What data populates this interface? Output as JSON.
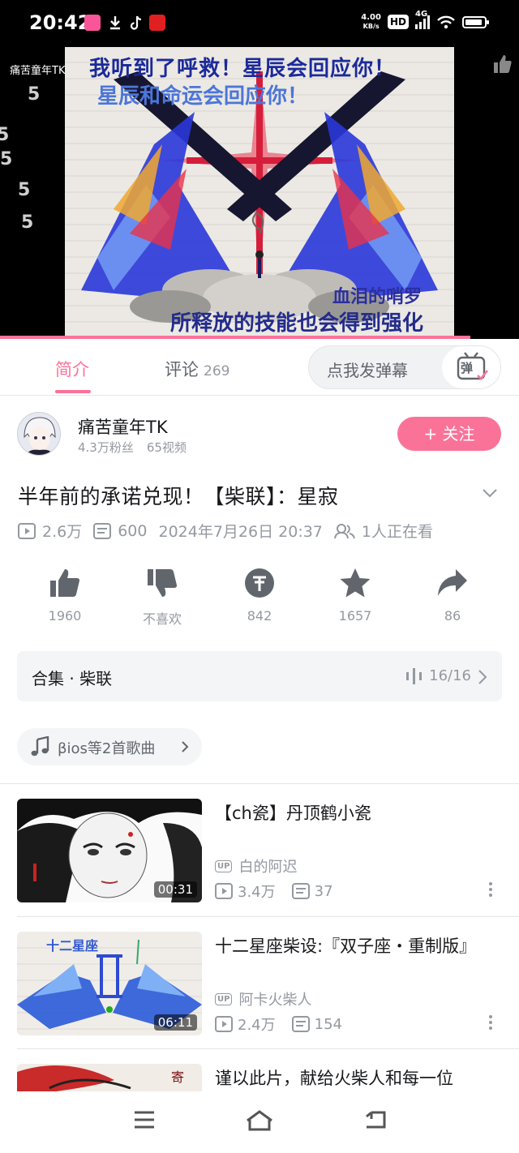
{
  "status_bar": {
    "time": "20:42",
    "speed_value": "4.00",
    "speed_unit": "KB/s",
    "hd_label": "HD",
    "network": "4G"
  },
  "video": {
    "danmaku_user": "痛苦童年TK",
    "danmaku_numbers": [
      "5",
      "5",
      "5",
      "5",
      "5"
    ],
    "overlay_line1": "我听到了呼救！星辰会回应你！",
    "overlay_line1b": "星辰和命运会回应你！",
    "overlay_line2": "血泪的哨罗",
    "overlay_line3": "所释放的技能也会得到强化",
    "progress_fraction": 0.906
  },
  "tabs": {
    "intro": "简介",
    "comments": "评论",
    "comments_count": "269",
    "danmaku_placeholder": "点我发弹幕",
    "danmaku_button": "弹"
  },
  "uploader": {
    "name": "痛苦童年TK",
    "fans": "4.3万粉丝",
    "videos": "65视频",
    "follow_label": "+ 关注"
  },
  "video_info": {
    "title": "半年前的承诺兑现！【柴联】：星寂",
    "views": "2.6万",
    "danmaku_count": "600",
    "date": "2024年7月26日 20:37",
    "watching": "1人正在看"
  },
  "actions": [
    {
      "label": "1960",
      "icon": "like-icon"
    },
    {
      "label": "不喜欢",
      "icon": "dislike-icon"
    },
    {
      "label": "842",
      "icon": "coin-icon"
    },
    {
      "label": "1657",
      "icon": "star-icon"
    },
    {
      "label": "86",
      "icon": "share-icon"
    }
  ],
  "collection": {
    "title": "合集 · 柴联",
    "count": "16/16"
  },
  "music": {
    "label": "βios等2首歌曲"
  },
  "recommendations": [
    {
      "title": "【ch瓷】丹顶鹤小瓷",
      "duration": "00:31",
      "author": "白的阿迟",
      "views": "3.4万",
      "danmaku": "37"
    },
    {
      "title": "十二星座柴设:『双子座・重制版』",
      "duration": "06:11",
      "author": "阿卡火柴人",
      "views": "2.4万",
      "danmaku": "154",
      "thumb_caption": "十二星座"
    },
    {
      "title": "谨以此片，献给火柴人和每一位"
    }
  ],
  "colors": {
    "accent": "#fb7299",
    "text_secondary": "#9499a0",
    "panel_bg": "#f4f5f7"
  }
}
